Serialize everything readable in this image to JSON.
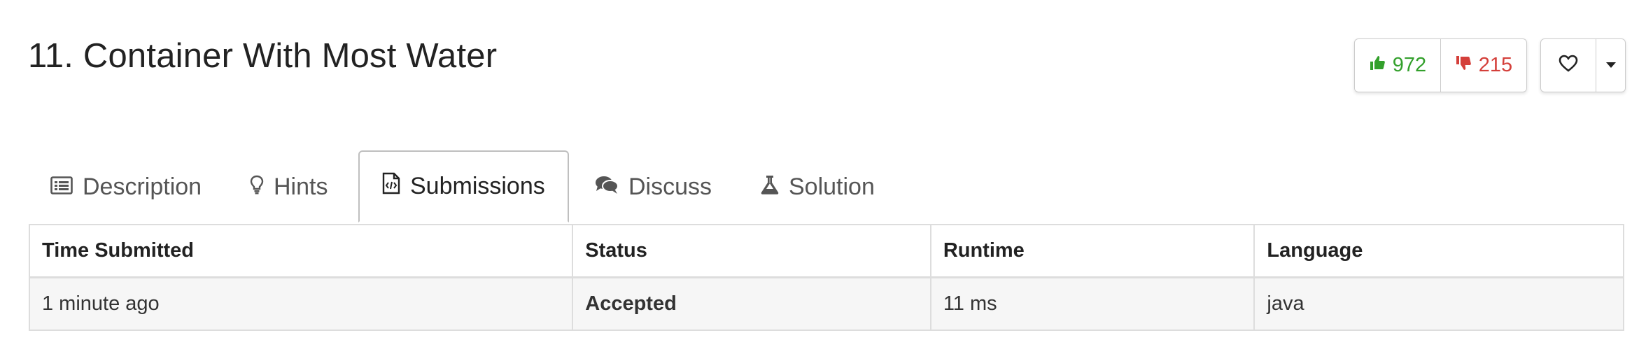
{
  "problem": {
    "title": "11. Container With Most Water"
  },
  "votes": {
    "likes": "972",
    "dislikes": "215",
    "like_color": "#33a02c",
    "dislike_color": "#d43f3a",
    "like_icon": "thumbs-up-icon",
    "dislike_icon": "thumbs-down-icon",
    "favorite_icon": "heart-icon",
    "menu_icon": "caret-down-icon"
  },
  "tabs": [
    {
      "label": "Description",
      "icon": "list-icon",
      "active": false
    },
    {
      "label": "Hints",
      "icon": "lightbulb-icon",
      "active": false
    },
    {
      "label": "Submissions",
      "icon": "code-file-icon",
      "active": true
    },
    {
      "label": "Discuss",
      "icon": "comments-icon",
      "active": false
    },
    {
      "label": "Solution",
      "icon": "flask-icon",
      "active": false
    }
  ],
  "submissions": {
    "columns": [
      "Time Submitted",
      "Status",
      "Runtime",
      "Language"
    ],
    "rows": [
      {
        "time": "1 minute ago",
        "status": "Accepted",
        "runtime": "11 ms",
        "language": "java"
      }
    ],
    "accepted_color": "#33a02c"
  }
}
